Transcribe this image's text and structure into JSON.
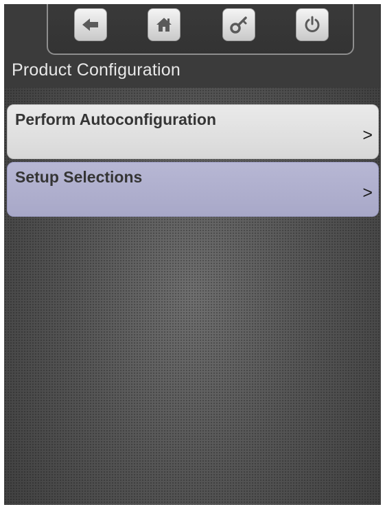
{
  "toolbar": {
    "buttons": [
      {
        "icon": "back-arrow-icon",
        "label": "Back"
      },
      {
        "icon": "home-icon",
        "label": "Home"
      },
      {
        "icon": "key-icon",
        "label": "Login"
      },
      {
        "icon": "power-icon",
        "label": "Power"
      }
    ]
  },
  "page": {
    "title": "Product Configuration"
  },
  "menu": {
    "items": [
      {
        "label": "Perform Autoconfiguration",
        "arrow": ">"
      },
      {
        "label": "Setup Selections",
        "arrow": ">"
      }
    ]
  },
  "colors": {
    "header_bg": "#3b3b3b",
    "item_default": "#e0e0e0",
    "item_selected": "#afafcf",
    "toolbar_icon": "#5a5a5a"
  }
}
